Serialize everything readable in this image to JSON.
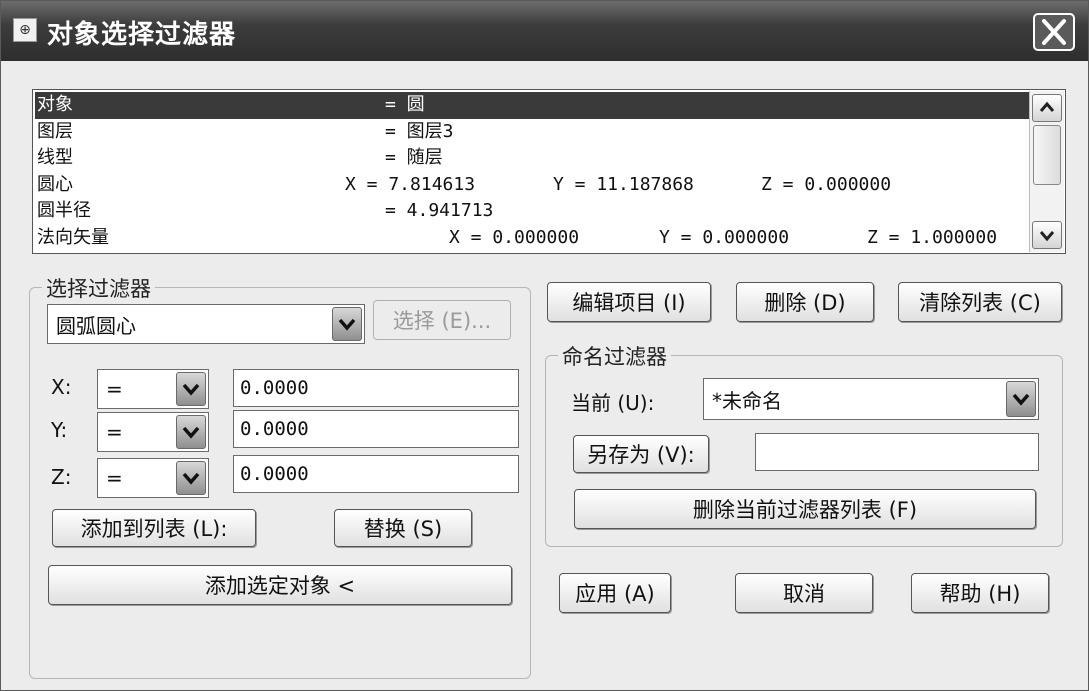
{
  "window": {
    "title": "对象选择过滤器"
  },
  "list": {
    "rows": [
      {
        "name": "对象",
        "c1": "= 圆",
        "c2": "",
        "c3": "",
        "c4": ""
      },
      {
        "name": "图层",
        "c1": "= 图层3",
        "c2": "",
        "c3": "",
        "c4": ""
      },
      {
        "name": "线型",
        "c1": "= 随层",
        "c2": "",
        "c3": "",
        "c4": ""
      },
      {
        "name": "圆心",
        "c1": "",
        "c2": "X = 7.814613",
        "c3": "Y = 11.187868",
        "c4": "Z = 0.000000"
      },
      {
        "name": "圆半径",
        "c1": "= 4.941713",
        "c2": "",
        "c3": "",
        "c4": ""
      },
      {
        "name": "法向矢量",
        "c1": "",
        "c2": "X = 0.000000",
        "c3": "Y = 0.000000",
        "c4": "Z = 1.000000"
      }
    ]
  },
  "select_filter": {
    "group_label": "选择过滤器",
    "type_value": "圆弧圆心",
    "select_button": "选择 (E)...",
    "x_label": "X:",
    "y_label": "Y:",
    "z_label": "Z:",
    "x_op": "=",
    "y_op": "=",
    "z_op": "=",
    "x_value": "0.0000",
    "y_value": "0.0000",
    "z_value": "0.0000",
    "add_to_list_button": "添加到列表 (L):",
    "replace_button": "替换 (S)",
    "add_selected_button": "添加选定对象 <"
  },
  "list_actions": {
    "edit_button": "编辑项目 (I)",
    "delete_button": "删除 (D)",
    "clear_button": "清除列表 (C)"
  },
  "named_filter": {
    "group_label": "命名过滤器",
    "current_label": "当前 (U):",
    "current_value": "*未命名",
    "save_as_button": "另存为 (V):",
    "save_as_value": "",
    "delete_current_button": "删除当前过滤器列表 (F)"
  },
  "footer": {
    "apply_button": "应用 (A)",
    "cancel_button": "取消",
    "help_button": "帮助 (H)"
  }
}
